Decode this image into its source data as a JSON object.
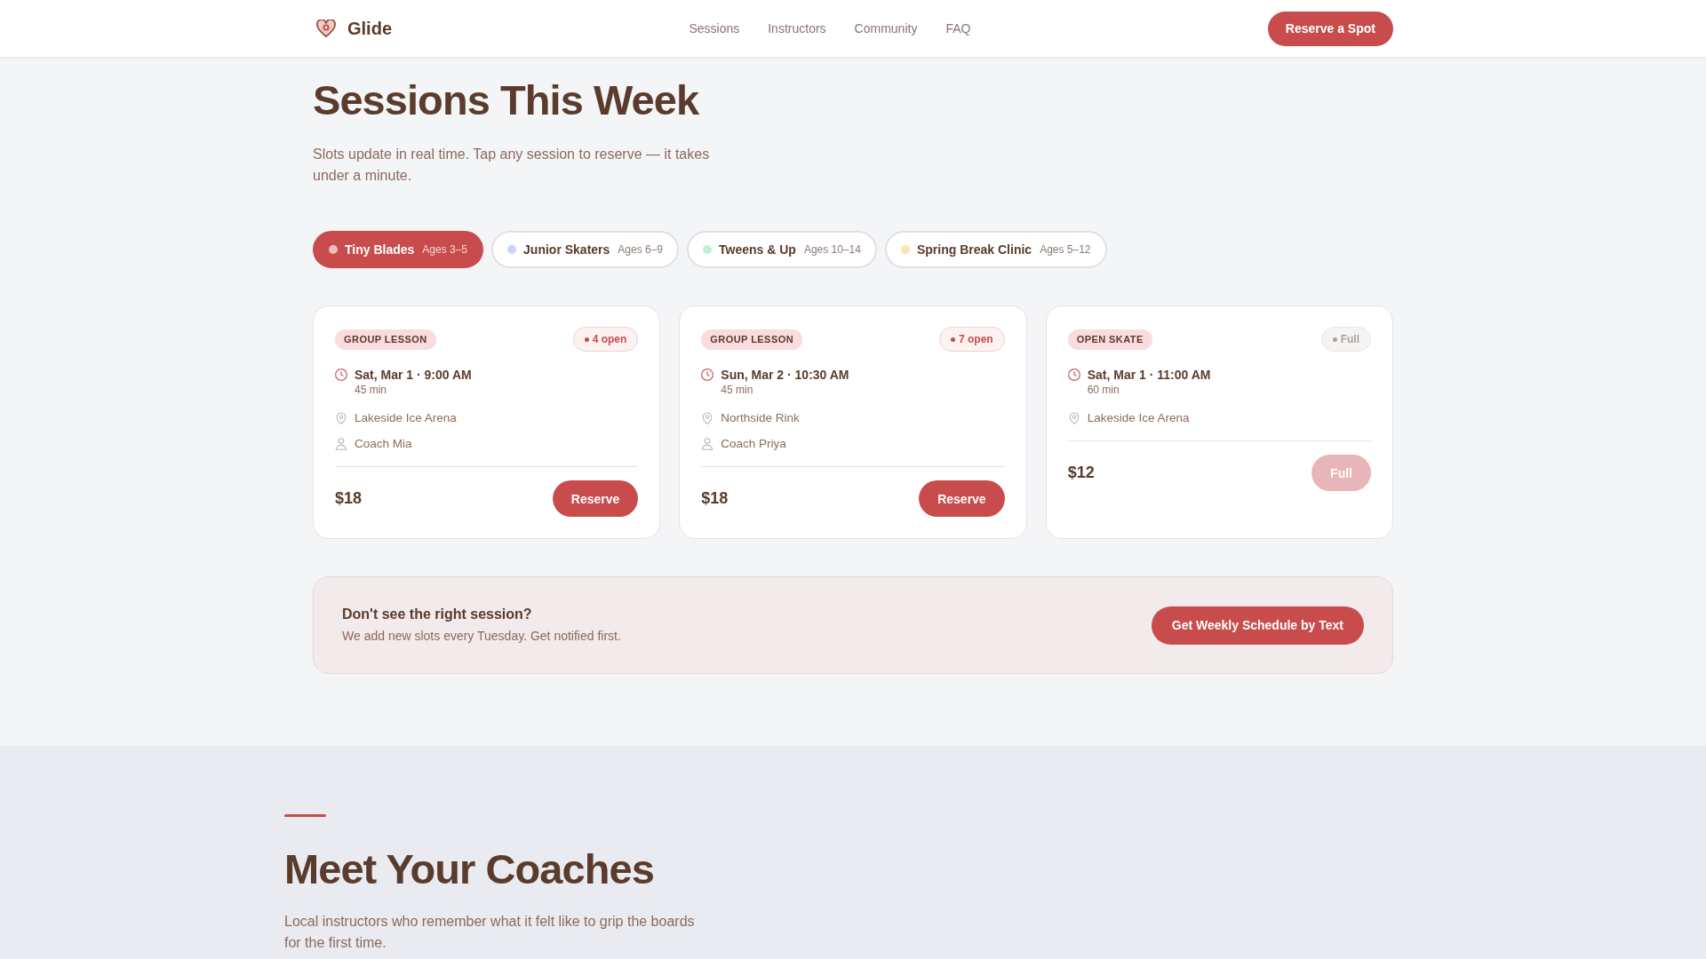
{
  "header": {
    "brand": "Glide",
    "nav": [
      "Sessions",
      "Instructors",
      "Community",
      "FAQ"
    ],
    "cta": "Reserve a Spot"
  },
  "sessions": {
    "title": "Sessions This Week",
    "subtitle": "Slots update in real time. Tap any session to reserve — it takes under a minute.",
    "filters": [
      {
        "label": "Tiny Blades",
        "ages": "Ages 3–5",
        "color": "#edbcbf",
        "selected": true
      },
      {
        "label": "Junior Skaters",
        "ages": "Ages 6–9",
        "color": "#c9d3fb",
        "selected": false
      },
      {
        "label": "Tweens & Up",
        "ages": "Ages 10–14",
        "color": "#bdf2cf",
        "selected": false
      },
      {
        "label": "Spring Break Clinic",
        "ages": "Ages 5–12",
        "color": "#f8e6b0",
        "selected": false
      }
    ],
    "cards": [
      {
        "tag": "GROUP LESSON",
        "availability": {
          "label": "4 open",
          "full": false
        },
        "time": "Sat, Mar 1 · 9:00 AM",
        "duration": "45 min",
        "details": [
          {
            "kind": "location",
            "text": "Lakeside Ice Arena"
          },
          {
            "kind": "coach",
            "text": "Coach Mia"
          }
        ],
        "price": "$18",
        "button": {
          "label": "Reserve",
          "disabled": false
        }
      },
      {
        "tag": "GROUP LESSON",
        "availability": {
          "label": "7 open",
          "full": false
        },
        "time": "Sun, Mar 2 · 10:30 AM",
        "duration": "45 min",
        "details": [
          {
            "kind": "location",
            "text": "Northside Rink"
          },
          {
            "kind": "coach",
            "text": "Coach Priya"
          }
        ],
        "price": "$18",
        "button": {
          "label": "Reserve",
          "disabled": false
        }
      },
      {
        "tag": "OPEN SKATE",
        "availability": {
          "label": "Full",
          "full": true
        },
        "time": "Sat, Mar 1 · 11:00 AM",
        "duration": "60 min",
        "details": [
          {
            "kind": "location",
            "text": "Lakeside Ice Arena"
          }
        ],
        "price": "$12",
        "button": {
          "label": "Full",
          "disabled": true
        }
      }
    ],
    "banner": {
      "title": "Don't see the right session?",
      "text": "We add new slots every Tuesday. Get notified first.",
      "button": "Get Weekly Schedule by Text"
    }
  },
  "coaches": {
    "title": "Meet Your Coaches",
    "text": "Local instructors who remember what it felt like to grip the boards for the first time."
  }
}
